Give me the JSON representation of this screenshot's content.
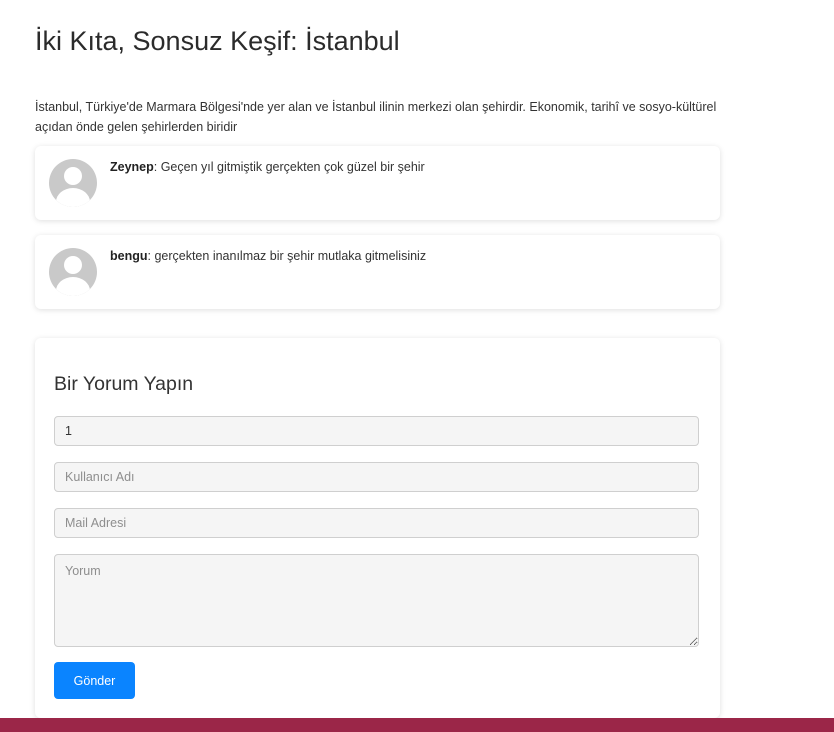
{
  "page": {
    "title": "İki Kıta, Sonsuz Keşif: İstanbul",
    "intro": "İstanbul, Türkiye'de Marmara Bölgesi'nde yer alan ve İstanbul ilinin merkezi olan şehirdir. Ekonomik, tarihî ve sosyo-kültürel açıdan önde gelen şehirlerden biridir"
  },
  "comments": [
    {
      "author": "Zeynep",
      "text": ": Geçen yıl gitmiştik gerçekten çok güzel bir şehir",
      "icon": "avatar-icon"
    },
    {
      "author": "bengu",
      "text": ": gerçekten inanılmaz bir şehir mutlaka gitmelisiniz",
      "icon": "avatar-icon"
    }
  ],
  "form": {
    "title": "Bir Yorum Yapın",
    "id_value": "1",
    "username_placeholder": "Kullanıcı Adı",
    "email_placeholder": "Mail Adresi",
    "comment_placeholder": "Yorum",
    "submit_label": "Gönder"
  },
  "colors": {
    "accent": "#0a84ff",
    "footer": "#9b2648"
  }
}
